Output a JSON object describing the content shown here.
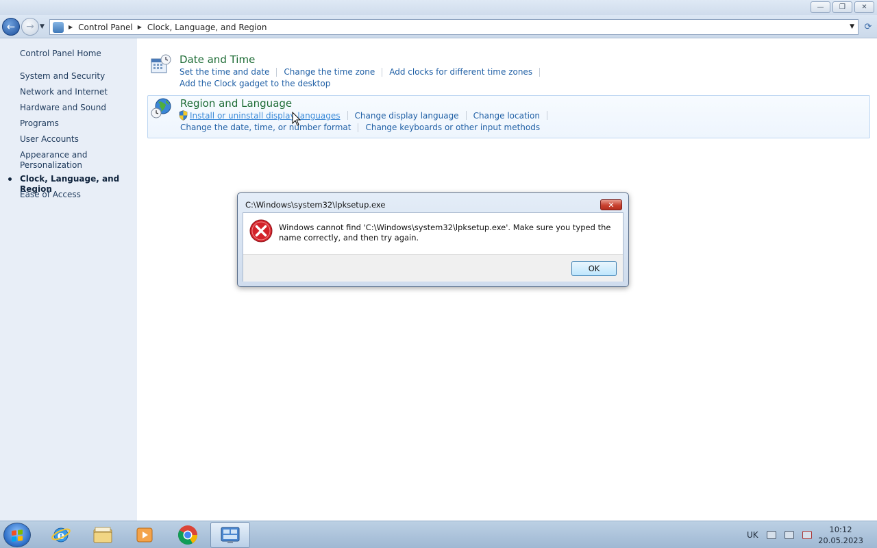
{
  "window": {
    "minimize_glyph": "—",
    "maximize_glyph": "❐",
    "close_glyph": "✕"
  },
  "navigation": {
    "back_icon": "back-arrow-icon",
    "forward_icon": "forward-arrow-icon",
    "breadcrumb": [
      "Control Panel",
      "Clock, Language, and Region"
    ],
    "refresh_icon": "refresh-icon"
  },
  "sidebar": {
    "home": "Control Panel Home",
    "items": [
      {
        "label": "System and Security",
        "active": false
      },
      {
        "label": "Network and Internet",
        "active": false
      },
      {
        "label": "Hardware and Sound",
        "active": false
      },
      {
        "label": "Programs",
        "active": false
      },
      {
        "label": "User Accounts",
        "active": false
      },
      {
        "label": "Appearance and Personalization",
        "active": false
      },
      {
        "label": "Clock, Language, and Region",
        "active": true
      },
      {
        "label": "Ease of Access",
        "active": false
      }
    ]
  },
  "main": {
    "categories": [
      {
        "title": "Date and Time",
        "icon": "calendar-clock-icon",
        "links": [
          "Set the time and date",
          "Change the time zone",
          "Add clocks for different time zones",
          "Add the Clock gadget to the desktop"
        ]
      },
      {
        "title": "Region and Language",
        "icon": "globe-clock-icon",
        "links": [
          "Install or uninstall display languages",
          "Change display language",
          "Change location",
          "Change the date, time, or number format",
          "Change keyboards or other input methods"
        ]
      }
    ]
  },
  "dialog": {
    "title": "C:\\Windows\\system32\\lpksetup.exe",
    "message": "Windows cannot find 'C:\\Windows\\system32\\lpksetup.exe'. Make sure you typed the name correctly, and then try again.",
    "ok_label": "OK",
    "icon": "error-icon"
  },
  "taskbar": {
    "apps": [
      {
        "name": "internet-explorer",
        "icon": "ie-icon",
        "active": false
      },
      {
        "name": "windows-explorer",
        "icon": "folder-icon",
        "active": false
      },
      {
        "name": "media-player",
        "icon": "media-player-icon",
        "active": false
      },
      {
        "name": "chrome",
        "icon": "chrome-icon",
        "active": false
      },
      {
        "name": "control-panel",
        "icon": "control-panel-icon",
        "active": true
      }
    ],
    "language": "UK",
    "time": "10:12",
    "date": "20.05.2023"
  },
  "colors": {
    "category_title": "#1c6b34",
    "link": "#1f5fa5",
    "sidebar_bg": "#e8eef7"
  }
}
